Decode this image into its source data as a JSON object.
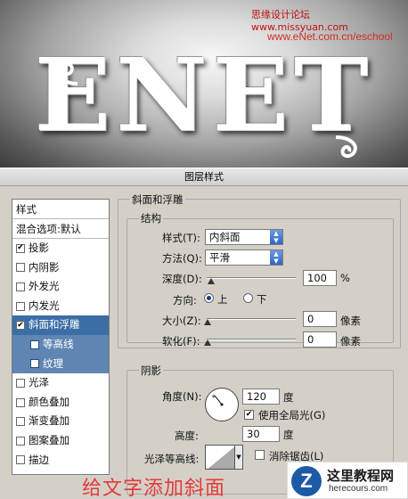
{
  "banner": {
    "watermark_top": "思缘设计论坛 www.missyuan.com",
    "watermark_url": "www.eNet.com.cn/eschool",
    "artwork_text": "ENET"
  },
  "dialog": {
    "title": "图层样式",
    "left_pane": {
      "header": "样式",
      "blend_options": "混合选项:默认",
      "items": [
        {
          "label": "投影",
          "checked": true
        },
        {
          "label": "内阴影",
          "checked": false
        },
        {
          "label": "外发光",
          "checked": false
        },
        {
          "label": "内发光",
          "checked": false
        },
        {
          "label": "斜面和浮雕",
          "checked": true,
          "selected": true
        },
        {
          "label": "等高线",
          "checked": false,
          "sub": true
        },
        {
          "label": "纹理",
          "checked": false,
          "sub": true
        },
        {
          "label": "光泽",
          "checked": false
        },
        {
          "label": "颜色叠加",
          "checked": false
        },
        {
          "label": "渐变叠加",
          "checked": false
        },
        {
          "label": "图案叠加",
          "checked": false
        },
        {
          "label": "描边",
          "checked": false
        }
      ]
    },
    "bevel": {
      "section_title": "斜面和浮雕",
      "structure_title": "结构",
      "style_label": "样式(T):",
      "style_value": "内斜面",
      "technique_label": "方法(Q):",
      "technique_value": "平滑",
      "depth_label": "深度(D):",
      "depth_value": "100",
      "depth_unit": "%",
      "direction_label": "方向:",
      "direction_up": "上",
      "direction_down": "下",
      "size_label": "大小(Z):",
      "size_value": "0",
      "size_unit": "像素",
      "soften_label": "软化(F):",
      "soften_value": "0",
      "soften_unit": "像素"
    },
    "shading": {
      "title": "阴影",
      "angle_label": "角度(N):",
      "angle_value": "120",
      "angle_unit": "度",
      "global_light_label": "使用全局光(G)",
      "altitude_label": "高度:",
      "altitude_value": "30",
      "altitude_unit": "度",
      "gloss_contour_label": "光泽等高线:",
      "anti_alias_label": "消除锯齿(L)"
    }
  },
  "caption": "给文字添加斜面",
  "watermark_bottom": {
    "logo_letter": "Z",
    "title": "这里教程网",
    "url": "herecours.com"
  },
  "colors": {
    "selection": "#3a6ea5",
    "sub_item": "#5f86b3",
    "caption": "#e43a3a",
    "dialog_bg": "#d4d0c8"
  }
}
